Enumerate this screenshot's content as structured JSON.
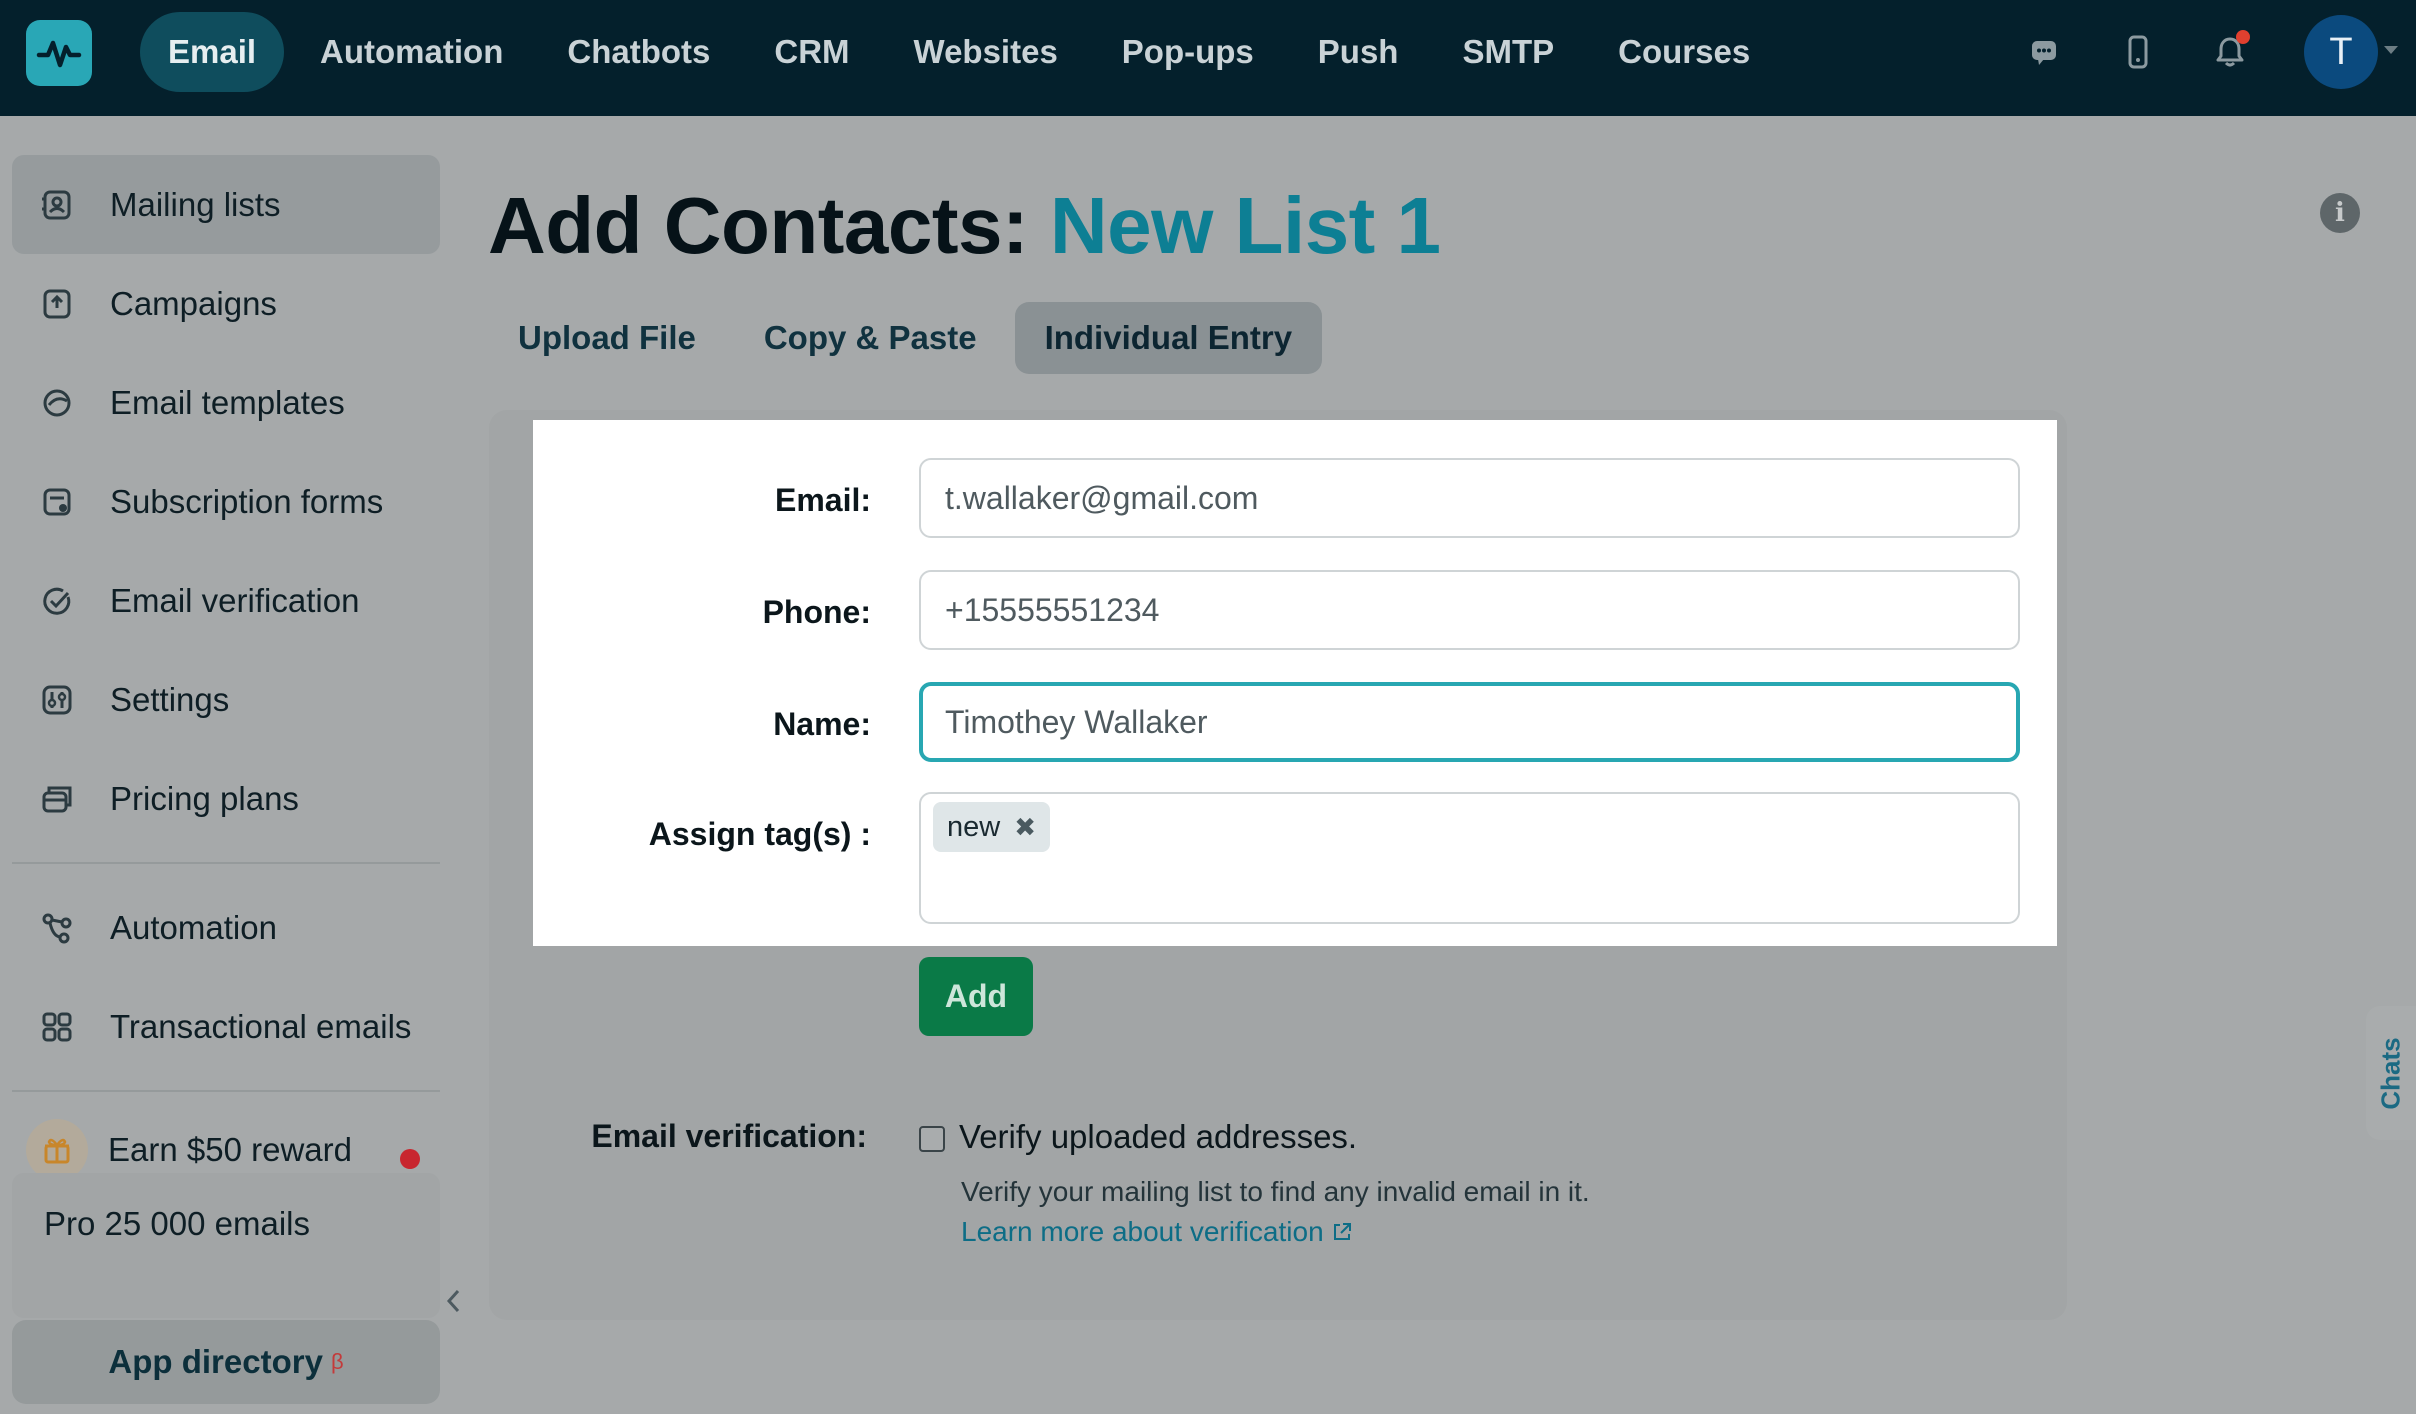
{
  "nav": {
    "items": [
      {
        "label": "Email",
        "active": true
      },
      {
        "label": "Automation"
      },
      {
        "label": "Chatbots"
      },
      {
        "label": "CRM"
      },
      {
        "label": "Websites"
      },
      {
        "label": "Pop-ups"
      },
      {
        "label": "Push"
      },
      {
        "label": "SMTP"
      },
      {
        "label": "Courses"
      }
    ],
    "icons": [
      "chat-icon",
      "mobile-icon",
      "bell-icon"
    ],
    "avatar_initial": "T"
  },
  "sidebar": {
    "items": [
      {
        "label": "Mailing lists",
        "icon": "contacts-icon",
        "active": true
      },
      {
        "label": "Campaigns",
        "icon": "campaign-icon"
      },
      {
        "label": "Email templates",
        "icon": "template-icon"
      },
      {
        "label": "Subscription forms",
        "icon": "form-icon"
      },
      {
        "label": "Email verification",
        "icon": "verify-icon"
      },
      {
        "label": "Settings",
        "icon": "settings-icon"
      },
      {
        "label": "Pricing plans",
        "icon": "pricing-icon"
      }
    ],
    "secondary": [
      {
        "label": "Automation",
        "icon": "automation-icon"
      },
      {
        "label": "Transactional emails",
        "icon": "grid-icon"
      }
    ],
    "reward": {
      "label": "Earn $50 reward",
      "icon": "gift-icon"
    },
    "plan": "Pro 25 000 emails",
    "app_directory": {
      "label": "App directory",
      "badge": "β"
    }
  },
  "page": {
    "title_prefix": "Add Contacts: ",
    "list_name": "New List 1"
  },
  "tabs": [
    {
      "label": "Upload File"
    },
    {
      "label": "Copy & Paste"
    },
    {
      "label": "Individual Entry",
      "active": true
    }
  ],
  "form": {
    "email_label": "Email:",
    "email_value": "t.wallaker@gmail.com",
    "phone_label": "Phone:",
    "phone_value": "+15555551234",
    "name_label": "Name:",
    "name_value": "Timothey Wallaker",
    "tags_label": "Assign tag(s) :",
    "tags": [
      "new"
    ],
    "tag_remove": "✖",
    "add_button": "Add"
  },
  "verification": {
    "label": "Email verification:",
    "checkbox_label": "Verify uploaded addresses.",
    "checked": false,
    "help": "Verify your mailing list to find any invalid email in it.",
    "link": "Learn more about verification"
  },
  "chats_tab": "Chats",
  "colors": {
    "topbar": "#04202c",
    "accent": "#0d7f94",
    "focus": "#28a7b2",
    "add_button": "#0a7a47"
  }
}
